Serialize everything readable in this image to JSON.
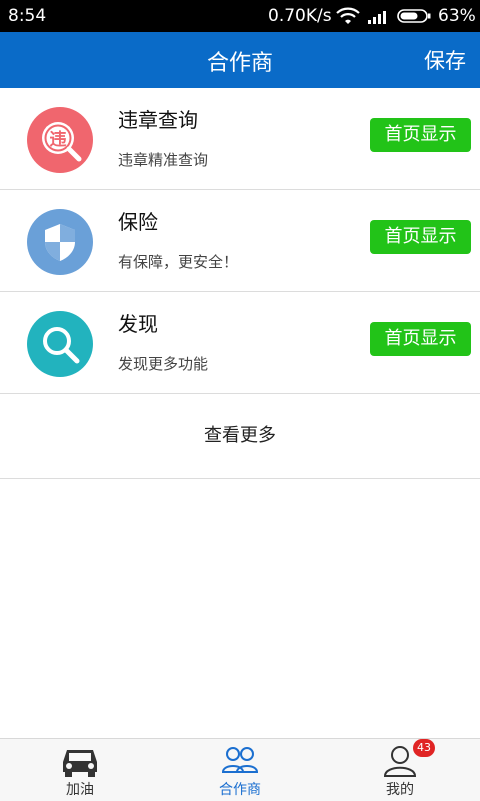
{
  "status_bar": {
    "time": "8:54",
    "speed": "0.70K/s",
    "battery": "63%"
  },
  "header": {
    "title": "合作商",
    "save_label": "保存"
  },
  "items": [
    {
      "name": "违章查询",
      "desc": "违章精准查询",
      "button": "首页显示",
      "icon": "violation-search-icon",
      "color": "#f0666e"
    },
    {
      "name": "保险",
      "desc": "有保障，更安全！",
      "button": "首页显示",
      "icon": "shield-icon",
      "color": "#6aa0d8"
    },
    {
      "name": "发现",
      "desc": "发现更多功能",
      "button": "首页显示",
      "icon": "search-icon",
      "color": "#22b3be"
    }
  ],
  "more_label": "查看更多",
  "tabs": [
    {
      "label": "加油",
      "icon": "car-icon"
    },
    {
      "label": "合作商",
      "icon": "partners-icon",
      "active": true
    },
    {
      "label": "我的",
      "icon": "user-icon",
      "badge": "43"
    }
  ],
  "colors": {
    "header": "#0a6bc8",
    "button": "#22c318",
    "active_tab": "#1b6fd0",
    "badge": "#e02424"
  }
}
